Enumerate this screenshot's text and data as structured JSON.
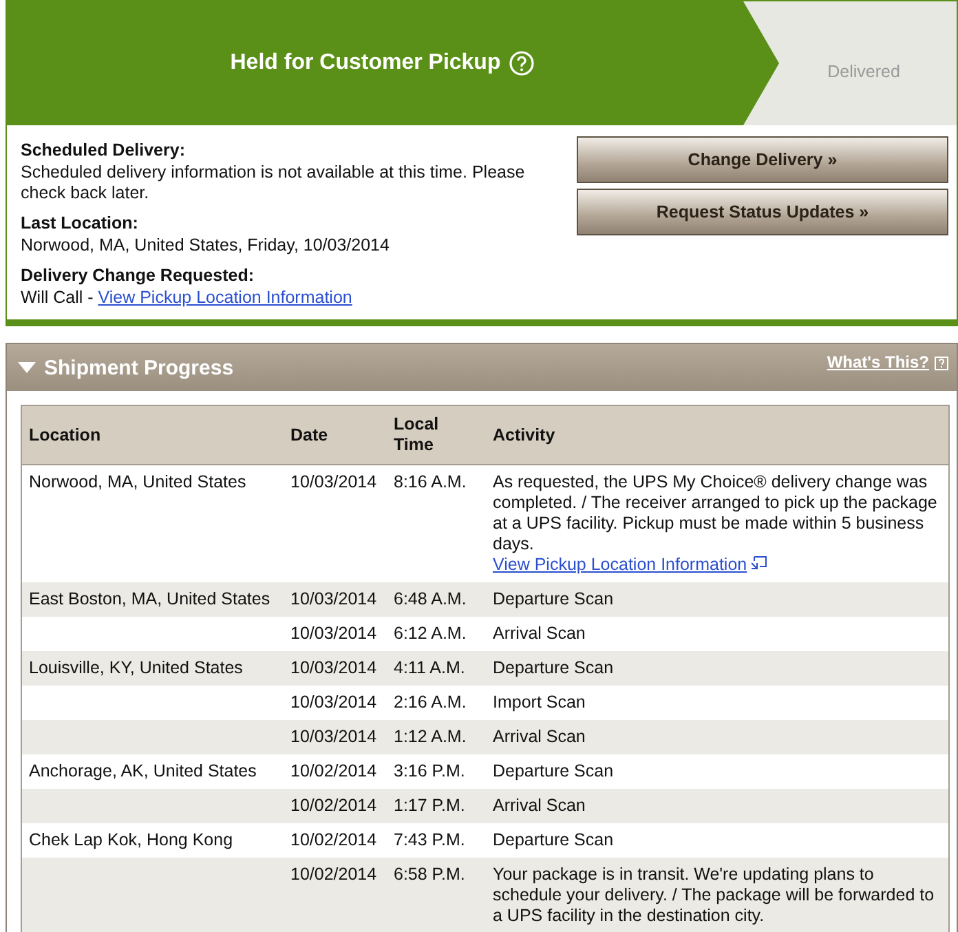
{
  "status_steps": [
    {
      "label": "Held for Customer Pickup",
      "current": true
    },
    {
      "label": "Delivered",
      "current": false
    }
  ],
  "details": [
    {
      "label": "Scheduled Delivery:",
      "value": "Scheduled delivery information is not available at this time. Please check back later."
    },
    {
      "label": "Last Location:",
      "value": "Norwood, MA, United States, Friday, 10/03/2014"
    },
    {
      "label": "Delivery Change Requested:",
      "value": "Will Call - ",
      "link": "View Pickup Location Information"
    }
  ],
  "buttons": [
    "Change Delivery »",
    "Request Status Updates »"
  ],
  "shipment_progress": {
    "title": "Shipment Progress",
    "expanded": true,
    "help_link": "What's This?",
    "columns": [
      "Location",
      "Date",
      "Local Time",
      "Activity"
    ],
    "rows": [
      {
        "location": "Norwood, MA, United States",
        "date": "10/03/2014",
        "time": "8:16 A.M.",
        "activity": "As requested, the UPS My Choice® delivery change was completed. / The receiver arranged to pick up the package at a UPS facility. Pickup must be made within 5 business days.",
        "link": "View Pickup Location Information"
      },
      {
        "location": "East Boston, MA, United States",
        "date": "10/03/2014",
        "time": "6:48 A.M.",
        "activity": "Departure Scan"
      },
      {
        "date": "10/03/2014",
        "time": "6:12 A.M.",
        "activity": "Arrival Scan"
      },
      {
        "location": "Louisville, KY, United States",
        "date": "10/03/2014",
        "time": "4:11 A.M.",
        "activity": "Departure Scan"
      },
      {
        "date": "10/03/2014",
        "time": "2:16 A.M.",
        "activity": "Import Scan"
      },
      {
        "date": "10/03/2014",
        "time": "1:12 A.M.",
        "activity": "Arrival Scan"
      },
      {
        "location": "Anchorage, AK, United States",
        "date": "10/02/2014",
        "time": "3:16 P.M.",
        "activity": "Departure Scan"
      },
      {
        "date": "10/02/2014",
        "time": "1:17 P.M.",
        "activity": "Arrival Scan"
      },
      {
        "location": "Chek Lap Kok, Hong Kong",
        "date": "10/02/2014",
        "time": "7:43 P.M.",
        "activity": "Departure Scan"
      },
      {
        "date": "10/02/2014",
        "time": "6:58 P.M.",
        "activity": "Your package is in transit. We're updating plans to schedule your delivery. / The package will be forwarded to a UPS facility in the destination city."
      }
    ]
  }
}
